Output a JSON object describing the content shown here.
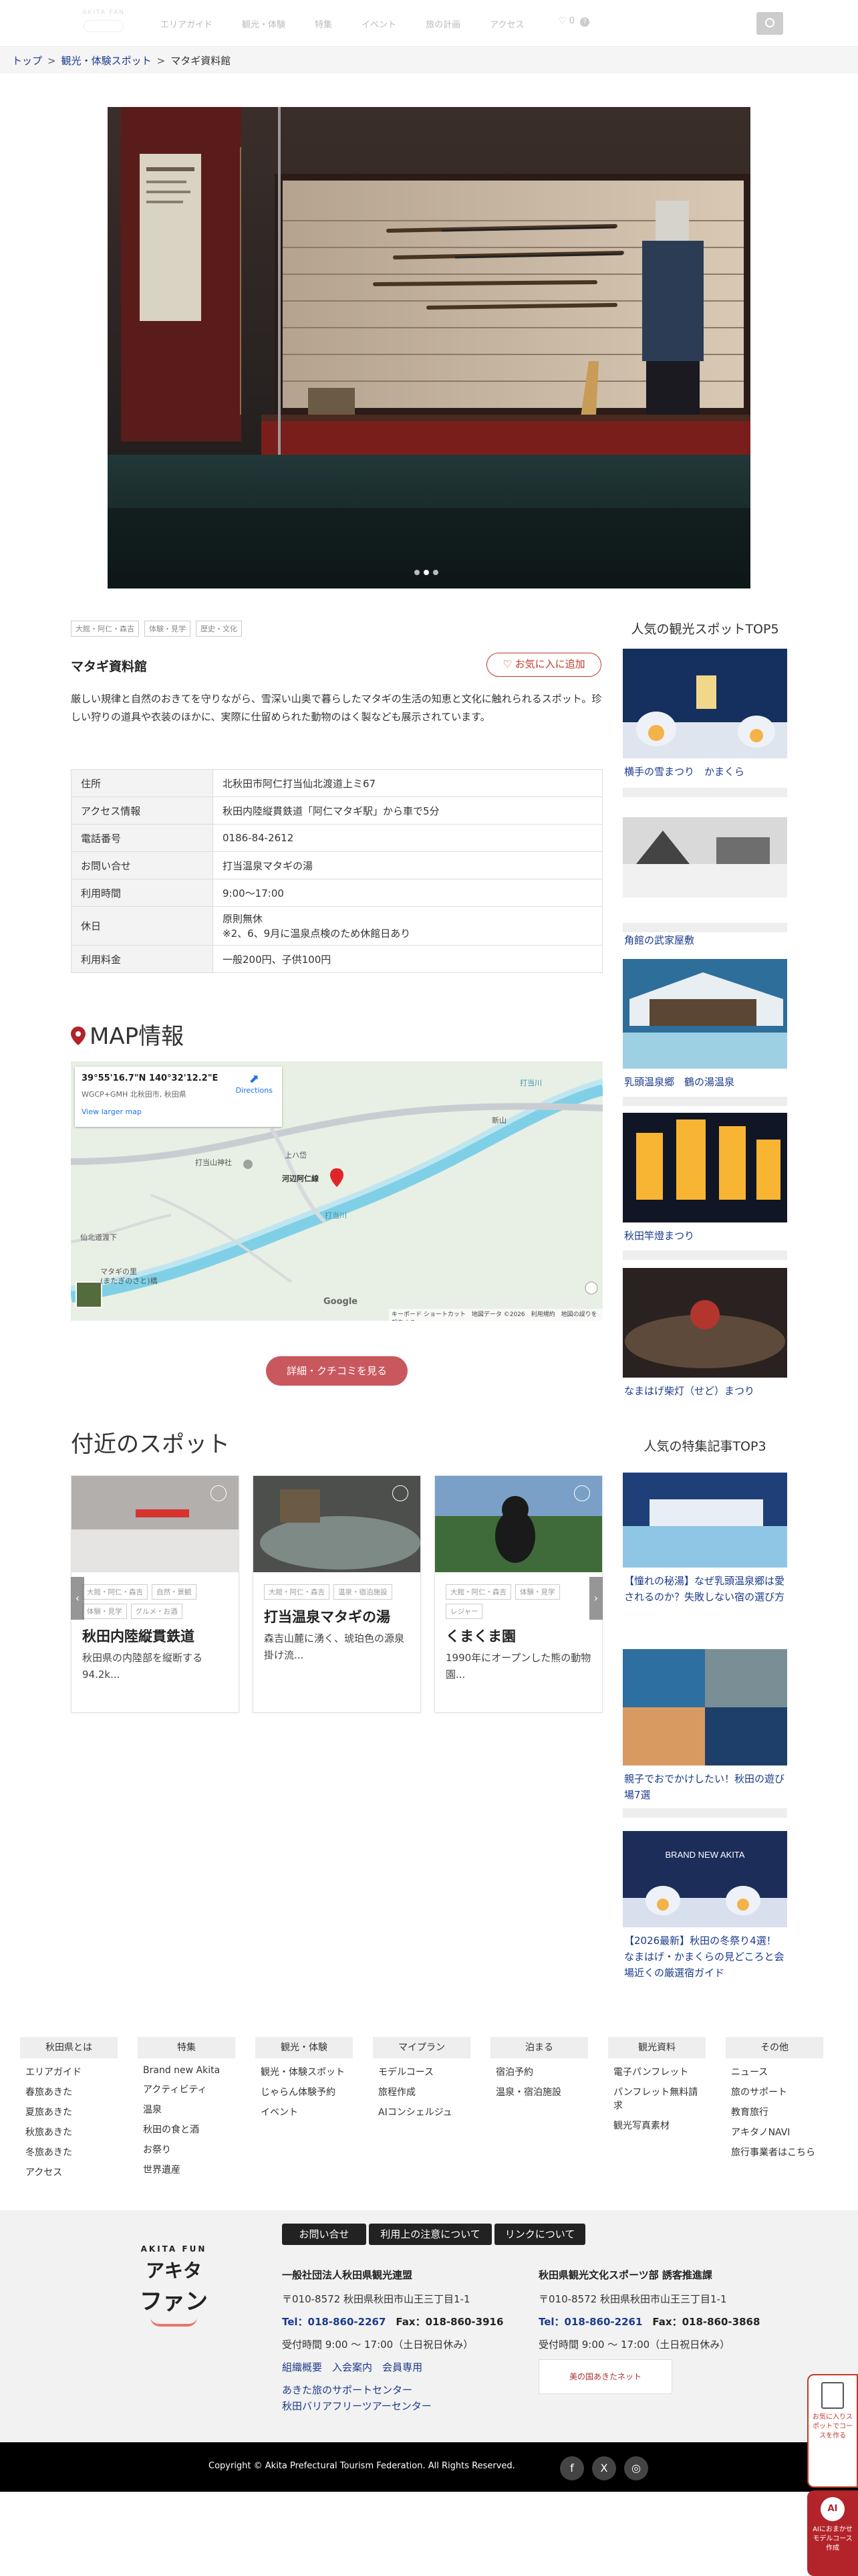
{
  "header": {
    "logo_text": "AKITA FAN",
    "nav": [
      "エリアガイド",
      "観光・体験",
      "特集",
      "イベント",
      "旅の計画",
      "アクセス"
    ],
    "favorites_count": "0"
  },
  "breadcrumb": {
    "items": [
      "トップ",
      "観光・体験スポット",
      "マタギ資料館"
    ]
  },
  "hero": {
    "slide_count": 3,
    "active_slide": 1
  },
  "spot": {
    "tags": [
      "大館・阿仁・森吉",
      "体験・見学",
      "歴史・文化"
    ],
    "title": "マタギ資料館",
    "favorite_button": "お気に入に追加",
    "description": "厳しい規律と自然のおきてを守りながら、雪深い山奥で暮らしたマタギの生活の知恵と文化に触れられるスポット。珍しい狩りの道具や衣装のほかに、実際に仕留められた動物のはく製なども展示されています。",
    "info": [
      {
        "key": "住所",
        "value": "北秋田市阿仁打当仙北渡道上ミ67"
      },
      {
        "key": "アクセス情報",
        "value": "秋田内陸縦貫鉄道「阿仁マタギ駅」から車で5分"
      },
      {
        "key": "電話番号",
        "value": "0186-84-2612"
      },
      {
        "key": "お問い合せ",
        "value": "打当温泉マタギの湯"
      },
      {
        "key": "利用時間",
        "value": "9:00〜17:00"
      },
      {
        "key": "休日",
        "value": "原則無休",
        "value2": "※2、6、9月に温泉点検のため休館日あり"
      },
      {
        "key": "利用料金",
        "value": "一般200円、子供100円"
      }
    ]
  },
  "map": {
    "heading": "MAP情報",
    "coords": "39°55'16.7\"N 140°32'12.2\"E",
    "address": "WGCP+GMH 北秋田市, 秋田県",
    "directions": "Directions",
    "larger_link": "View larger map",
    "labels": {
      "river1": "打当川",
      "river2": "打当川",
      "shrine": "打当山神社",
      "place": "河辺阿仁線",
      "pass": "上ハ岱",
      "north": "新山",
      "road": "仙北道渡下",
      "matagi": "マタギの里",
      "matagi2": "(またぎのさと)橋"
    },
    "footer": "キーボード ショートカット　地図データ ©2026　利用規約　地図の誤りを報告する",
    "google": "Google",
    "button": "詳細・クチコミを見る"
  },
  "nearby": {
    "heading": "付近のスポット",
    "cards": [
      {
        "tags": [
          "大館・阿仁・森吉",
          "自然・景観",
          "体験・見学",
          "グルメ・お酒"
        ],
        "title": "秋田内陸縦貫鉄道",
        "desc": "秋田県の内陸部を縦断する94.2k..."
      },
      {
        "tags": [
          "大館・阿仁・森吉",
          "温泉・宿泊施設"
        ],
        "title": "打当温泉マタギの湯",
        "desc": "森吉山麓に湧く、琥珀色の源泉掛け流..."
      },
      {
        "tags": [
          "大館・阿仁・森吉",
          "体験・見学",
          "レジャー"
        ],
        "title": "くまくま園",
        "desc": "1990年にオープンした熊の動物園..."
      }
    ]
  },
  "sidebar": {
    "top5_heading": "人気の観光スポットTOP5",
    "top5": [
      "横手の雪まつり　かまくら",
      "角館の武家屋敷",
      "乳頭温泉郷　鶴の湯温泉",
      "秋田竿燈まつり",
      "なまはげ柴灯（せど）まつり"
    ],
    "top3_heading": "人気の特集記事TOP3",
    "top3": [
      "【憧れの秘湯】なぜ乳頭温泉郷は愛されるのか？失敗しない宿の選び方",
      "親子でおでかけしたい！秋田の遊び場7選",
      "【2026最新】秋田の冬祭り4選！なまはげ・かまくらの見どころと会場近くの厳選宿ガイド"
    ],
    "banner_text": "BRAND NEW AKITA"
  },
  "footer_nav": [
    {
      "head": "秋田県とは",
      "links": [
        "エリアガイド",
        "春旅あきた",
        "夏旅あきた",
        "秋旅あきた",
        "冬旅あきた",
        "アクセス"
      ]
    },
    {
      "head": "特集",
      "links": [
        "Brand new Akita",
        "アクティビティ",
        "温泉",
        "秋田の食と酒",
        "お祭り",
        "世界遺産"
      ]
    },
    {
      "head": "観光・体験",
      "links": [
        "観光・体験スポット",
        "じゃらん体験予約",
        "イベント"
      ]
    },
    {
      "head": "マイプラン",
      "links": [
        "モデルコース",
        "旅程作成",
        "AIコンシェルジュ"
      ]
    },
    {
      "head": "泊まる",
      "links": [
        "宿泊予約",
        "温泉・宿泊施設"
      ]
    },
    {
      "head": "観光資料",
      "links": [
        "電子パンフレット",
        "パンフレット無料請求",
        "観光写真素材"
      ]
    },
    {
      "head": "その他",
      "links": [
        "ニュース",
        "旅のサポート",
        "教育旅行",
        "アキタノNAVI",
        "旅行事業者はこちら"
      ]
    }
  ],
  "footer": {
    "brand_top": "AKITA FUN",
    "brand_main": "アキタ",
    "brand_sub": "ファン",
    "buttons": [
      "お問い合せ",
      "利用上の注意について",
      "リンクについて"
    ],
    "org1": {
      "name": "一般社団法人秋田県観光連盟",
      "addr": "〒010-8572 秋田県秋田市山王三丁目1-1",
      "tel": "Tel：018-860-2267",
      "fax": "Fax：018-860-3916",
      "hours": "受付時間 9:00 〜 17:00（土日祝日休み）",
      "link1": "組織概要",
      "link2": "入会案内",
      "link3": "会員専用",
      "link4": "あきた旅のサポートセンター",
      "link5": "秋田バリアフリーツアーセンター"
    },
    "org2": {
      "name": "秋田県観光文化スポーツ部 誘客推進課",
      "addr": "〒010-8572 秋田県秋田市山王三丁目1-1",
      "tel": "Tel：018-860-2261",
      "fax": "Fax：018-860-3868",
      "hours": "受付時間 9:00 〜 17:00（土日祝日休み）",
      "banner": "美の国あきたネット"
    },
    "copyright": "Copyright © Akita Prefectural Tourism Federation. All Rights Reserved."
  },
  "floating": {
    "model_course": "お気に入りスポットでコースを作る",
    "ai": "AIにおまかせモデルコース作成",
    "ai_badge": "AI"
  }
}
